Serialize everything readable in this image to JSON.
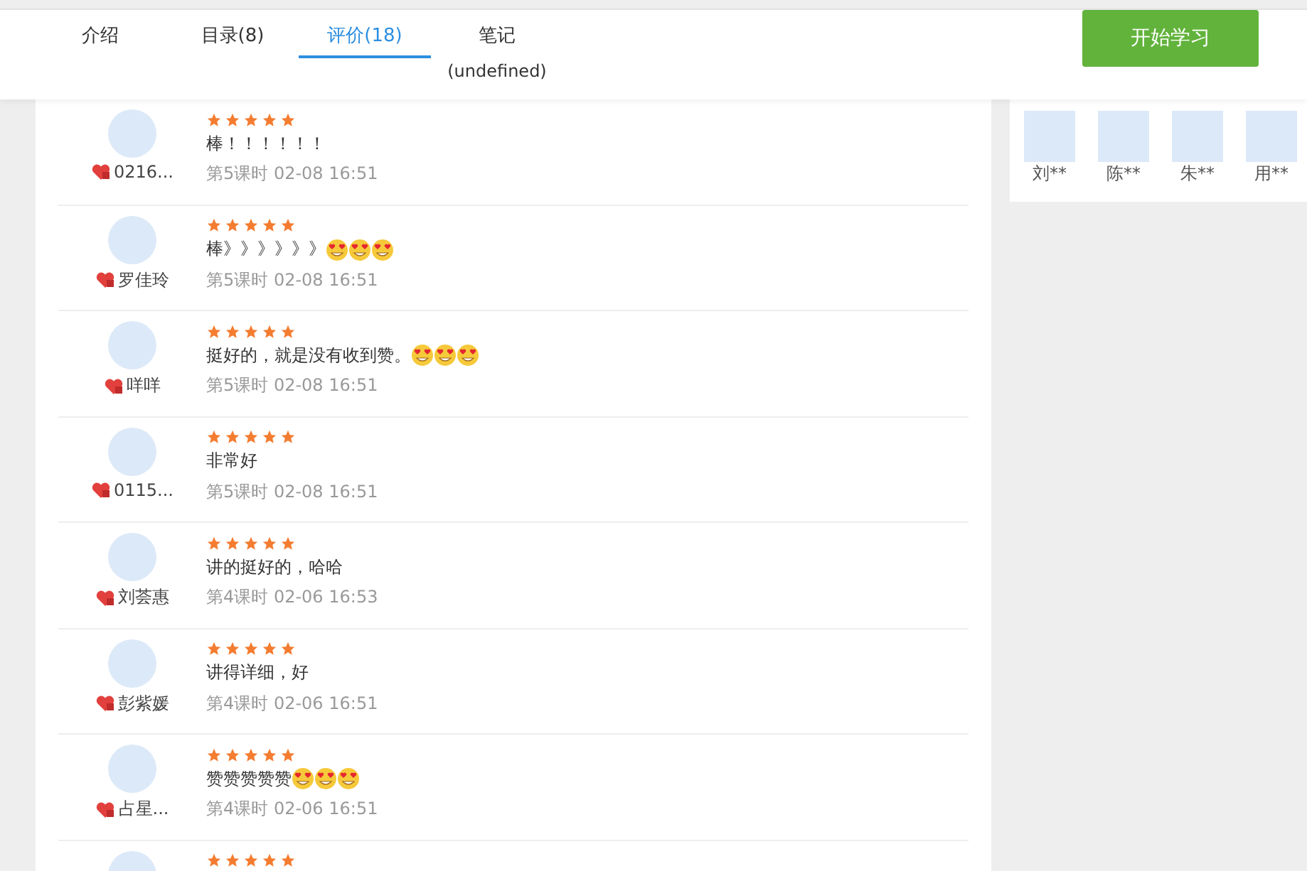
{
  "tabs": [
    {
      "label": "介绍",
      "selected": false
    },
    {
      "label": "目录(8)",
      "selected": false
    },
    {
      "label": "评价(18)",
      "selected": true
    },
    {
      "label": "笔记",
      "note": "(undefined)",
      "selected": false
    }
  ],
  "start_button": "开始学习",
  "reviews": [
    {
      "name": "0216...",
      "stars": 5,
      "text": "棒！！！！！！",
      "meta": "第5课时 02-08 16:51"
    },
    {
      "name": "罗佳玲",
      "stars": 5,
      "text": "棒》》》》》》",
      "emojis": [
        {
          "kind": "heart-eyes"
        },
        {
          "kind": "heart-eyes"
        },
        {
          "kind": "heart-eyes"
        }
      ],
      "meta": "第5课时 02-08 16:51"
    },
    {
      "name": "咩咩",
      "stars": 5,
      "text": "挺好的，就是没有收到赞。",
      "emojis": [
        {
          "kind": "heart-eyes"
        },
        {
          "kind": "heart-eyes"
        },
        {
          "kind": "heart-eyes"
        }
      ],
      "meta": "第5课时 02-08 16:51"
    },
    {
      "name": "0115...",
      "stars": 5,
      "text": "非常好",
      "meta": "第5课时 02-08 16:51"
    },
    {
      "name": "刘荟惠",
      "stars": 5,
      "text": "讲的挺好的，哈哈",
      "meta": "第4课时 02-06 16:53"
    },
    {
      "name": "彭紫媛",
      "stars": 5,
      "text": "讲得详细，好",
      "meta": "第4课时 02-06 16:51"
    },
    {
      "name": "占星...",
      "stars": 5,
      "text": "赞赞赞赞赞",
      "emojis": [
        {
          "kind": "heart-eyes"
        },
        {
          "kind": "heart-eyes"
        },
        {
          "kind": "heart-eyes"
        }
      ],
      "meta": "第4课时 02-06 16:51"
    },
    {
      "stars": 5
    }
  ],
  "learners": [
    {
      "name": "刘**"
    },
    {
      "name": "陈**"
    },
    {
      "name": "朱**"
    },
    {
      "name": "用**"
    }
  ]
}
